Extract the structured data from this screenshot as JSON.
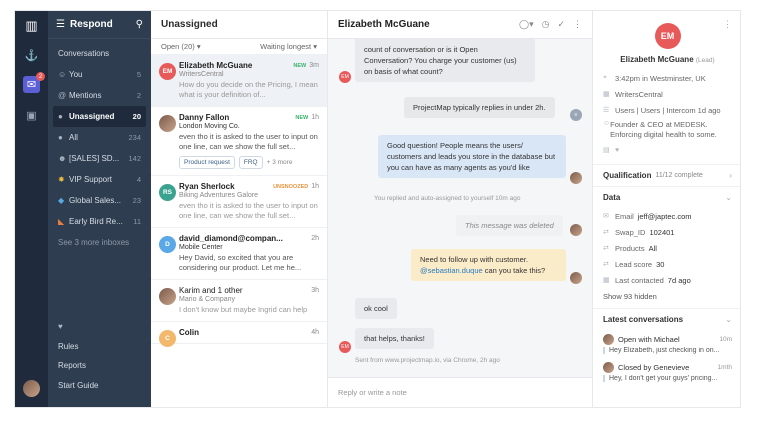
{
  "nav": {
    "title": "Respond",
    "conversations": "Conversations",
    "items": [
      {
        "label": "You",
        "count": "5"
      },
      {
        "label": "Mentions",
        "count": "2"
      },
      {
        "label": "Unassigned",
        "count": "20"
      },
      {
        "label": "All",
        "count": "234"
      },
      {
        "label": "[SALES] SD...",
        "count": "142"
      },
      {
        "label": "VIP Support",
        "count": "4"
      },
      {
        "label": "Global Sales...",
        "count": "23"
      },
      {
        "label": "Early Bird Re...",
        "count": "11"
      }
    ],
    "see_more": "See 3 more inboxes",
    "rules": "Rules",
    "reports": "Reports",
    "start_guide": "Start Guide",
    "badge": "2"
  },
  "list": {
    "title": "Unassigned",
    "filter": "Open (20)",
    "sort": "Waiting longest",
    "items": [
      {
        "initials": "EM",
        "name": "Elizabeth McGuane",
        "tag": "NEW",
        "time": "3m",
        "company": "WritersCentral",
        "preview": "How do you decide on the Pricing, I mean what is your definition of..."
      },
      {
        "name": "Danny Fallon",
        "tag": "NEW",
        "time": "1h",
        "company": "London Moving Co.",
        "preview": "even tho it is asked to the user to input on one line, can we show the full set...",
        "chips": [
          "Product request",
          "FRQ"
        ],
        "more": "+ 3 more"
      },
      {
        "initials": "RS",
        "name": "Ryan Sherlock",
        "tag": "UNSNOOZED",
        "time": "1h",
        "company": "Biking Adventures Galore",
        "preview": "even tho it is asked to the user to input on one line, can we show the full set..."
      },
      {
        "initials": "D",
        "name": "david_diamond@compan...",
        "time": "2h",
        "company": "Mobile Center",
        "preview": "Hey David, so excited that you are considering our product. Let me he..."
      },
      {
        "name": "Karim and 1 other",
        "time": "3h",
        "company": "Mario & Company",
        "preview": "I don't know but maybe Ingrid can help"
      },
      {
        "initials": "C",
        "name": "Colin",
        "time": "4h",
        "company": "",
        "preview": ""
      }
    ]
  },
  "conv": {
    "title": "Elizabeth McGuane",
    "m1": "count of conversation or is it Open Conversation? You charge your customer (us) on basis of what count?",
    "m2": "ProjectMap typically replies in under 2h.",
    "m3": "Good question! People means the users/ customers and leads you store in the database but you can have as many agents as you'd like",
    "meta1": "You replied and auto-assigned to yourself 10m ago",
    "m4": "This message was deleted",
    "m5a": "Need to follow up with customer.",
    "m5b": "@sebastian.duque",
    "m5c": " can you take this?",
    "m6": "ok cool",
    "m7": "that helps, thanks!",
    "meta2": "Sent from www.projectmap.io, via Chrome, 2h ago",
    "reply": "Reply or write a note",
    "av": "EM"
  },
  "side": {
    "initials": "EM",
    "name": "Elizabeth McGuane",
    "lead": "(Lead)",
    "rows": [
      "3:42pm in Westminster, UK",
      "WritersCentral",
      "Users | Users | Intercom 1d ago",
      "Founder & CEO at MEDESK. Enforcing digital health to some."
    ],
    "qualification": "Qualification",
    "qual_status": "11/12 complete",
    "data": "Data",
    "email_k": "Email",
    "email_v": "jeff@japtec.com",
    "swap_k": "Swap_ID",
    "swap_v": "102401",
    "products_k": "Products",
    "products_v": "All",
    "lead_k": "Lead score",
    "lead_v": "30",
    "contacted_k": "Last contacted",
    "contacted_v": "7d ago",
    "show_hidden": "Show 93 hidden",
    "latest": "Latest conversations",
    "c1": "Open with Michael",
    "c1t": "10m",
    "c1p": "Hey Elizabeth, just checking in on...",
    "c2": "Closed by Genevieve",
    "c2t": "1mth",
    "c2p": "Hey, I don't get your guys' pricing..."
  },
  "colors": {
    "accent": "#e85a5a",
    "brand": "#2e3d4f"
  }
}
